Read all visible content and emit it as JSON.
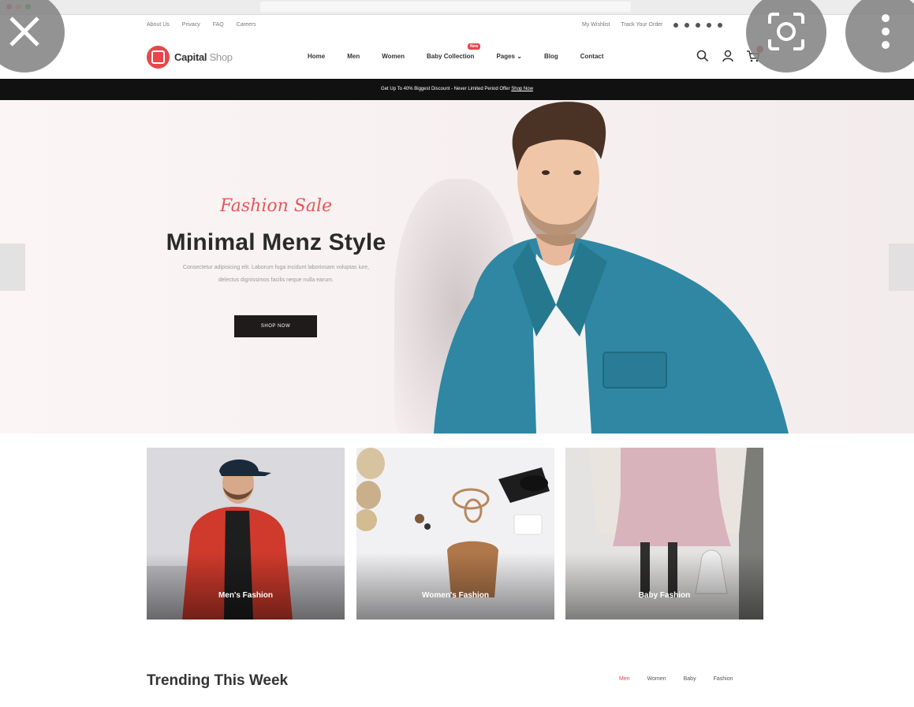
{
  "browser": {
    "url": "",
    "traffic_colors": [
      "#ff5f57",
      "#febc2e",
      "#28c840"
    ]
  },
  "topbar": {
    "links": [
      "About Us",
      "Privacy",
      "FAQ",
      "Careers"
    ],
    "right_links": [
      "My Wishlist",
      "Track Your Order"
    ]
  },
  "header": {
    "logo_bold": "Capital",
    "logo_light": "Shop",
    "nav": [
      "Home",
      "Men",
      "Women",
      "Baby Collection",
      "Pages",
      "Blog",
      "Contact"
    ],
    "nav_badge": "New"
  },
  "promo": {
    "text": "Get Up To 40% Biggest Discount - Never Limited Period Offer",
    "link": "Shop Now"
  },
  "hero": {
    "kicker": "Fashion Sale",
    "title": "Minimal Menz Style",
    "description": "Consectetur adipisicing elit. Laborum fuga incidunt laboriosam voluptas iure, delectus dignissimos facilis neque nulla earum.",
    "cta": "SHOP NOW"
  },
  "categories": [
    {
      "label": "Men's Fashion"
    },
    {
      "label": "Women's Fashion"
    },
    {
      "label": "Baby Fashion"
    }
  ],
  "trending": {
    "title": "Trending This Week",
    "tabs": [
      "Men",
      "Women",
      "Baby",
      "Fashion"
    ]
  },
  "colors": {
    "accent": "#e8464a",
    "dark": "#111111"
  }
}
